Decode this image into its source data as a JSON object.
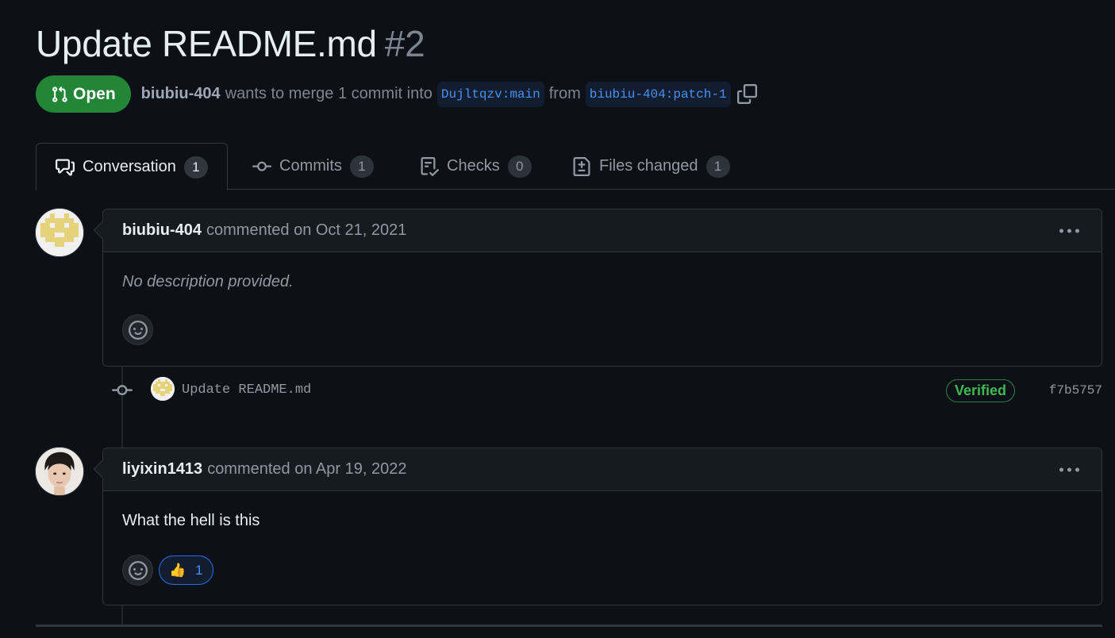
{
  "pr": {
    "title": "Update README.md",
    "number": "#2",
    "state": "Open",
    "author": "biubiu-404",
    "merge_text": "wants to merge 1 commit into",
    "base_branch": "Dujltqzv:main",
    "from_text": "from",
    "head_branch": "biubiu-404:patch-1"
  },
  "tabs": [
    {
      "label": "Conversation",
      "count": "1",
      "icon": "comment-discussion-icon"
    },
    {
      "label": "Commits",
      "count": "1",
      "icon": "git-commit-icon"
    },
    {
      "label": "Checks",
      "count": "0",
      "icon": "checklist-icon"
    },
    {
      "label": "Files changed",
      "count": "1",
      "icon": "file-diff-icon"
    }
  ],
  "comments": [
    {
      "author": "biubiu-404",
      "action": "commented on Oct 21, 2021",
      "body": "No description provided."
    },
    {
      "author": "liyixin1413",
      "action": "commented on Apr 19, 2022",
      "body": "What the hell is this",
      "reaction_emoji": "👍",
      "reaction_count": "1"
    }
  ],
  "commit": {
    "message": "Update README.md",
    "badge": "Verified",
    "sha": "f7b5757"
  },
  "colors": {
    "background": "#0d1117",
    "open_green": "#238636",
    "link_blue": "#4493f8",
    "verified_green": "#3fb950"
  }
}
